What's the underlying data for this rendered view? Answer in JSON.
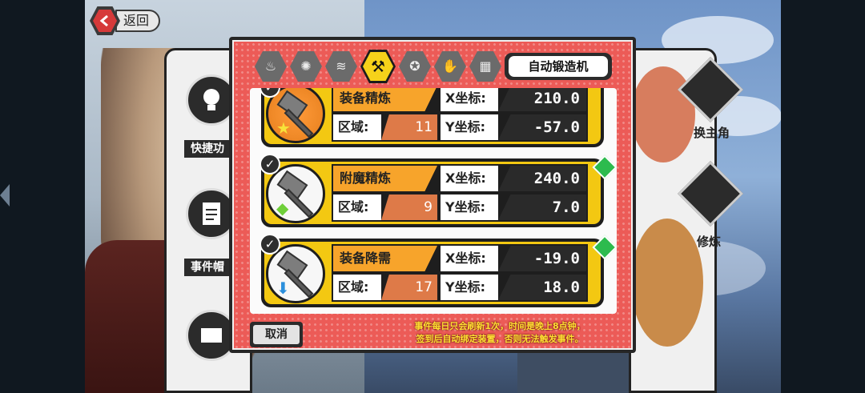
{
  "back_button": {
    "label": "返回"
  },
  "side_left": {
    "items": [
      {
        "icon": "lightbulb-icon",
        "label": "快捷功"
      },
      {
        "icon": "document-icon",
        "label": "事件帽"
      }
    ]
  },
  "side_right": {
    "items": [
      {
        "label": "换主角"
      },
      {
        "label": "修炼"
      }
    ]
  },
  "tabs": [
    {
      "icon": "flame-small-icon",
      "active": false
    },
    {
      "icon": "flame-burst-icon",
      "active": false
    },
    {
      "icon": "coin-stack-icon",
      "active": false
    },
    {
      "icon": "hammer-icon",
      "active": true
    },
    {
      "icon": "star-badge-icon",
      "active": false
    },
    {
      "icon": "glove-icon",
      "active": false
    },
    {
      "icon": "grid-icon",
      "active": false
    }
  ],
  "auto_forge_button": {
    "label": "自动锻造机"
  },
  "rows": [
    {
      "name": "装备精炼",
      "region_label": "区域:",
      "region": "11",
      "x_label": "X坐标:",
      "x": "210.0",
      "y_label": "Y坐标:",
      "y": "-57.0",
      "checked": true,
      "badge": "star-icon",
      "gem": false
    },
    {
      "name": "附魔精炼",
      "region_label": "区域:",
      "region": "9",
      "x_label": "X坐标:",
      "x": "240.0",
      "y_label": "Y坐标:",
      "y": "7.0",
      "checked": true,
      "badge": "green-gem-icon",
      "gem": true
    },
    {
      "name": "装备降需",
      "region_label": "区域:",
      "region": "17",
      "x_label": "X坐标:",
      "x": "-19.0",
      "y_label": "Y坐标:",
      "y": "18.0",
      "checked": true,
      "badge": "down-arrow-icon",
      "gem": true
    }
  ],
  "cancel_button": {
    "label": "取消"
  },
  "notice": {
    "line1": "事件每日只会刷新1次，时间是晚上8点钟，",
    "line2": "签到后自动绑定装置，否则无法触发事件。"
  }
}
